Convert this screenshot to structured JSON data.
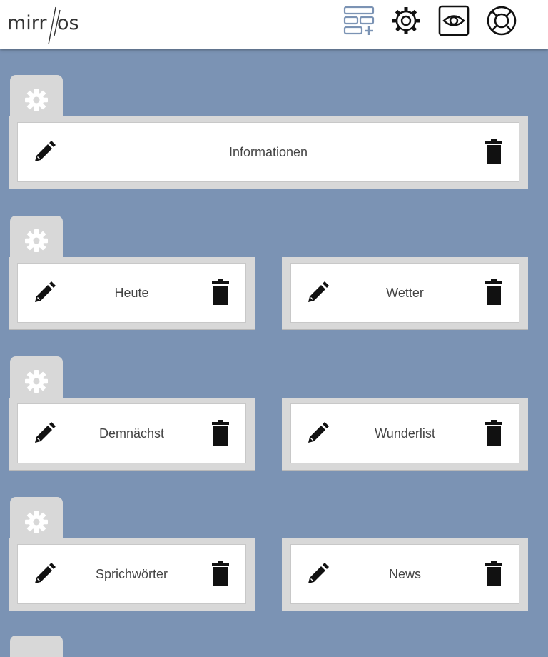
{
  "header": {
    "logo_part1": "mirr",
    "logo_part2": "os",
    "icons": [
      "add-layout-icon",
      "gear-icon",
      "eye-icon",
      "lifebuoy-icon"
    ],
    "colors": {
      "background": "#7b93b4",
      "bar": "#ffffff",
      "add_icon": "#7b93b4"
    }
  },
  "rows": [
    {
      "modules": [
        {
          "name": "Informationen"
        }
      ]
    },
    {
      "modules": [
        {
          "name": "Heute"
        },
        {
          "name": "Wetter"
        }
      ]
    },
    {
      "modules": [
        {
          "name": "Demnächst"
        },
        {
          "name": "Wunderlist"
        }
      ]
    },
    {
      "modules": [
        {
          "name": "Sprichwörter"
        },
        {
          "name": "News"
        }
      ]
    }
  ]
}
